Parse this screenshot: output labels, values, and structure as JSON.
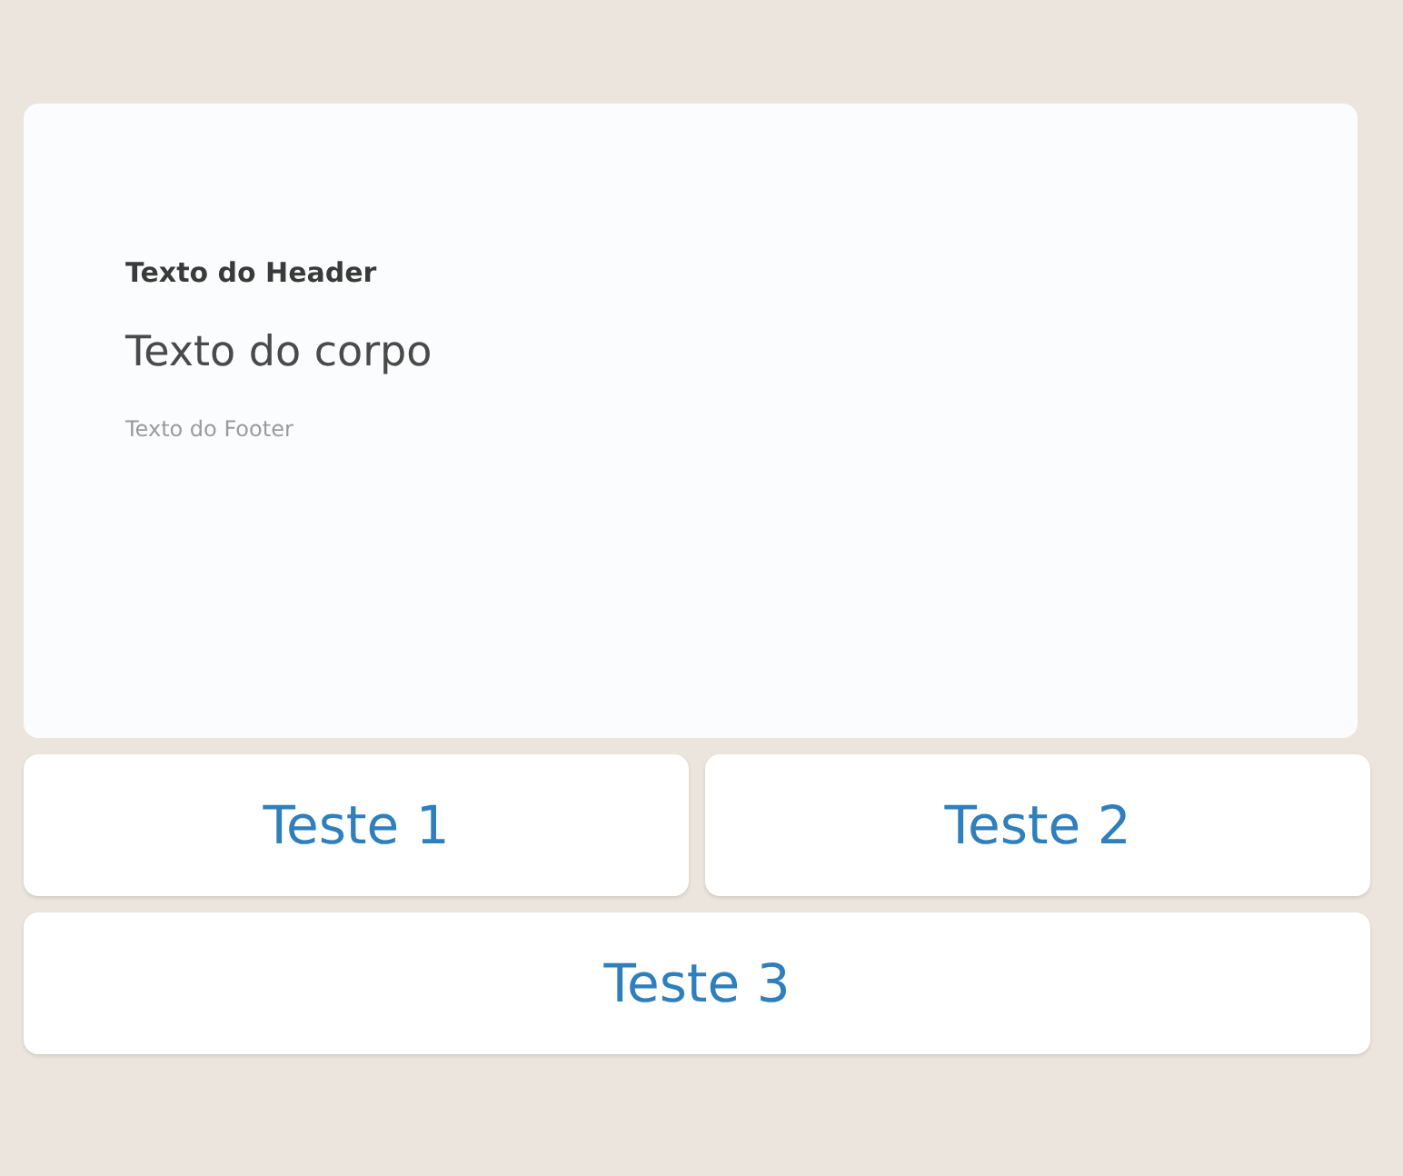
{
  "message": {
    "header": "Texto do Header",
    "body": "Texto do corpo",
    "footer": "Texto do Footer"
  },
  "button_rows": [
    [
      {
        "label": "Teste 1"
      },
      {
        "label": "Teste 2"
      }
    ],
    [
      {
        "label": "Teste 3"
      }
    ]
  ]
}
